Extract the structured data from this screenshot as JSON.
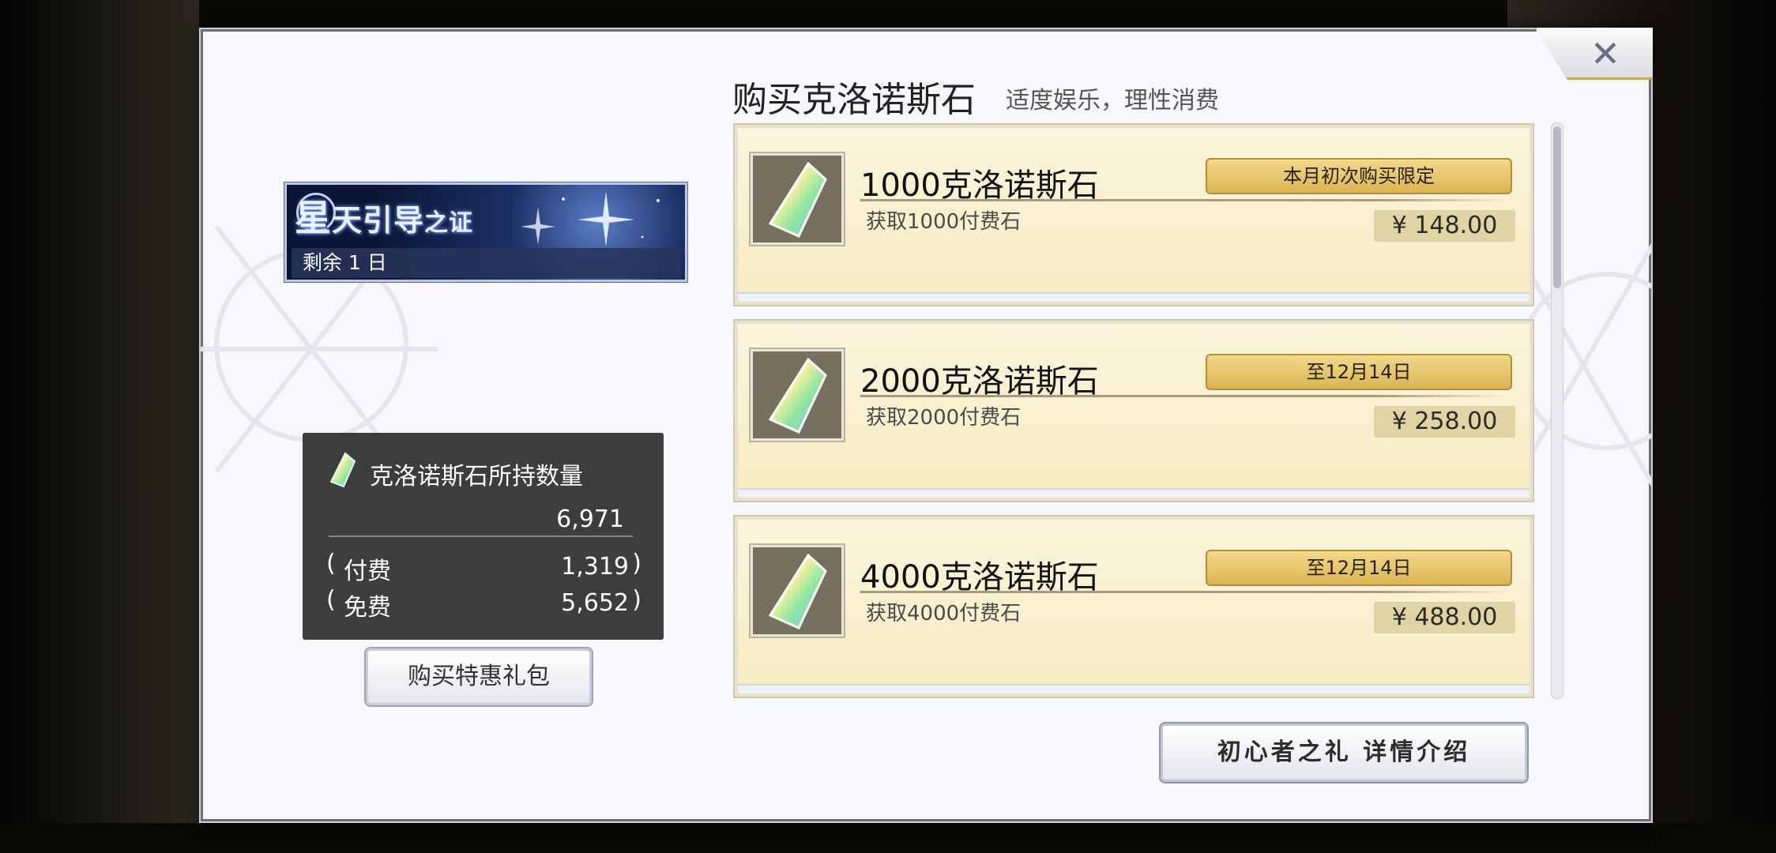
{
  "dialog": {
    "title": "购买克洛诺斯石",
    "note": "适度娱乐，理性消费",
    "close_label": "✕"
  },
  "event_banner": {
    "logo_big": "星",
    "logo_text": "天引导",
    "logo_small": "之证",
    "remaining": "剩余 1 日"
  },
  "holdings": {
    "title": "克洛诺斯石所持数量",
    "total": "6,971",
    "paid_label": "付费",
    "paid_value": "1,319",
    "free_label": "免费",
    "free_value": "5,652",
    "paren_open": "(",
    "paren_close": ")"
  },
  "buttons": {
    "gift_pack": "购买特惠礼包",
    "beginner": "初心者之礼 详情介绍"
  },
  "items": [
    {
      "name": "1000克洛诺斯石",
      "desc": "获取1000付费石",
      "badge": "本月初次购买限定",
      "price": "¥  148.00"
    },
    {
      "name": "2000克洛诺斯石",
      "desc": "获取2000付费石",
      "badge": "至12月14日",
      "price": "¥  258.00"
    },
    {
      "name": "4000克洛诺斯石",
      "desc": "获取4000付费石",
      "badge": "至12月14日",
      "price": "¥  488.00"
    }
  ],
  "scroll": {
    "thumb_fraction": 0.28
  },
  "colors": {
    "badge_gold": "#d9b452",
    "card_bg": "#f6ebc1",
    "holdings_bg": "#3d3d3d"
  }
}
